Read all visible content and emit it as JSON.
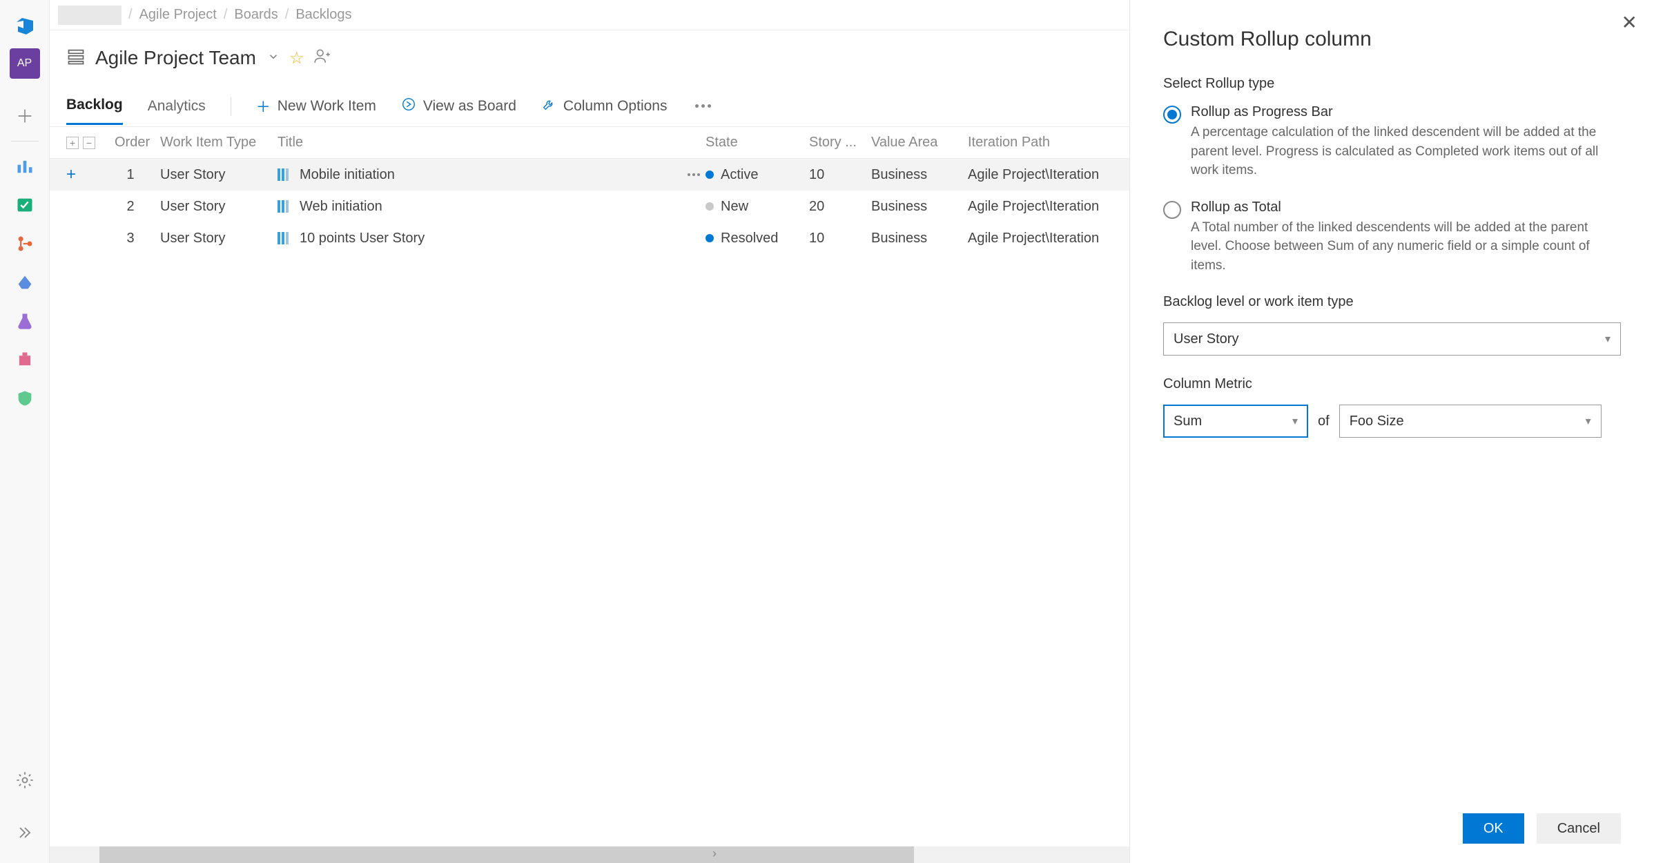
{
  "breadcrumbs": {
    "items": [
      "Agile Project",
      "Boards",
      "Backlogs"
    ]
  },
  "team": {
    "title": "Agile Project Team"
  },
  "tabs": {
    "backlog": "Backlog",
    "analytics": "Analytics"
  },
  "toolbar": {
    "new_item": "New Work Item",
    "view_board": "View as Board",
    "column_options": "Column Options"
  },
  "grid": {
    "headers": {
      "order": "Order",
      "type": "Work Item Type",
      "title": "Title",
      "state": "State",
      "story": "Story ...",
      "value": "Value Area",
      "iter": "Iteration Path"
    },
    "rows": [
      {
        "order": "1",
        "type": "User Story",
        "title": "Mobile initiation",
        "state": "Active",
        "state_cls": "state-active",
        "story": "10",
        "value": "Business",
        "iter": "Agile Project\\Iteration",
        "hover": true
      },
      {
        "order": "2",
        "type": "User Story",
        "title": "Web initiation",
        "state": "New",
        "state_cls": "state-new",
        "story": "20",
        "value": "Business",
        "iter": "Agile Project\\Iteration",
        "hover": false
      },
      {
        "order": "3",
        "type": "User Story",
        "title": "10 points User Story",
        "state": "Resolved",
        "state_cls": "state-resolved",
        "story": "10",
        "value": "Business",
        "iter": "Agile Project\\Iteration",
        "hover": false
      }
    ]
  },
  "panel": {
    "title": "Custom Rollup column",
    "select_type_label": "Select Rollup type",
    "radios": [
      {
        "title": "Rollup as Progress Bar",
        "desc": "A percentage calculation of the linked descendent will be added at the parent level. Progress is calculated as Completed work items out of all work items.",
        "selected": true
      },
      {
        "title": "Rollup as Total",
        "desc": "A Total number of the linked descendents will be added at the parent level. Choose between Sum of any numeric field or a simple count of items.",
        "selected": false
      }
    ],
    "backlog_label": "Backlog level or work item type",
    "backlog_value": "User Story",
    "metric_label": "Column Metric",
    "metric_agg": "Sum",
    "metric_of": "of",
    "metric_field": "Foo Size",
    "ok": "OK",
    "cancel": "Cancel"
  },
  "rail": {
    "ap": "AP"
  }
}
